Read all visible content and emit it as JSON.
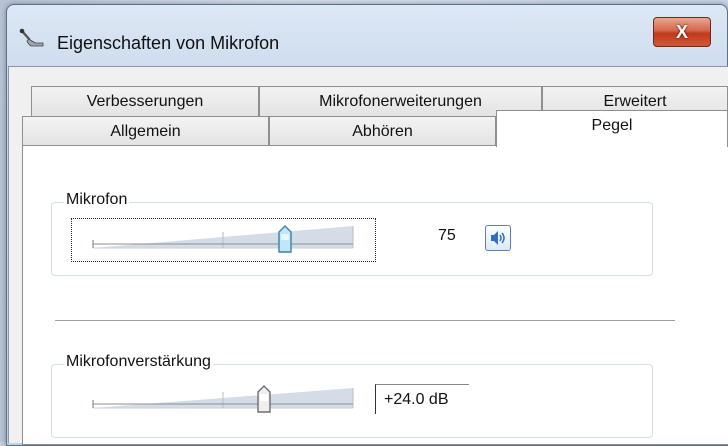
{
  "window": {
    "title": "Eigenschaften von Mikrofon",
    "close_label": "X"
  },
  "tabs": {
    "row_back": [
      {
        "label": "Verbesserungen"
      },
      {
        "label": "Mikrofonerweiterungen"
      },
      {
        "label": "Erweitert"
      }
    ],
    "row_front": [
      {
        "label": "Allgemein"
      },
      {
        "label": "Abhören"
      },
      {
        "label": "Pegel"
      }
    ],
    "active": "Pegel"
  },
  "levels": {
    "microphone": {
      "label": "Mikrofon",
      "value": "75",
      "level_fraction": 0.75,
      "mute_icon": "speaker-icon"
    },
    "boost": {
      "label": "Mikrofonverstärkung",
      "value": "+24.0 dB",
      "level_fraction": 0.58
    }
  },
  "colors": {
    "accent": "#2f6fc4",
    "close_red": "#c0391c"
  }
}
